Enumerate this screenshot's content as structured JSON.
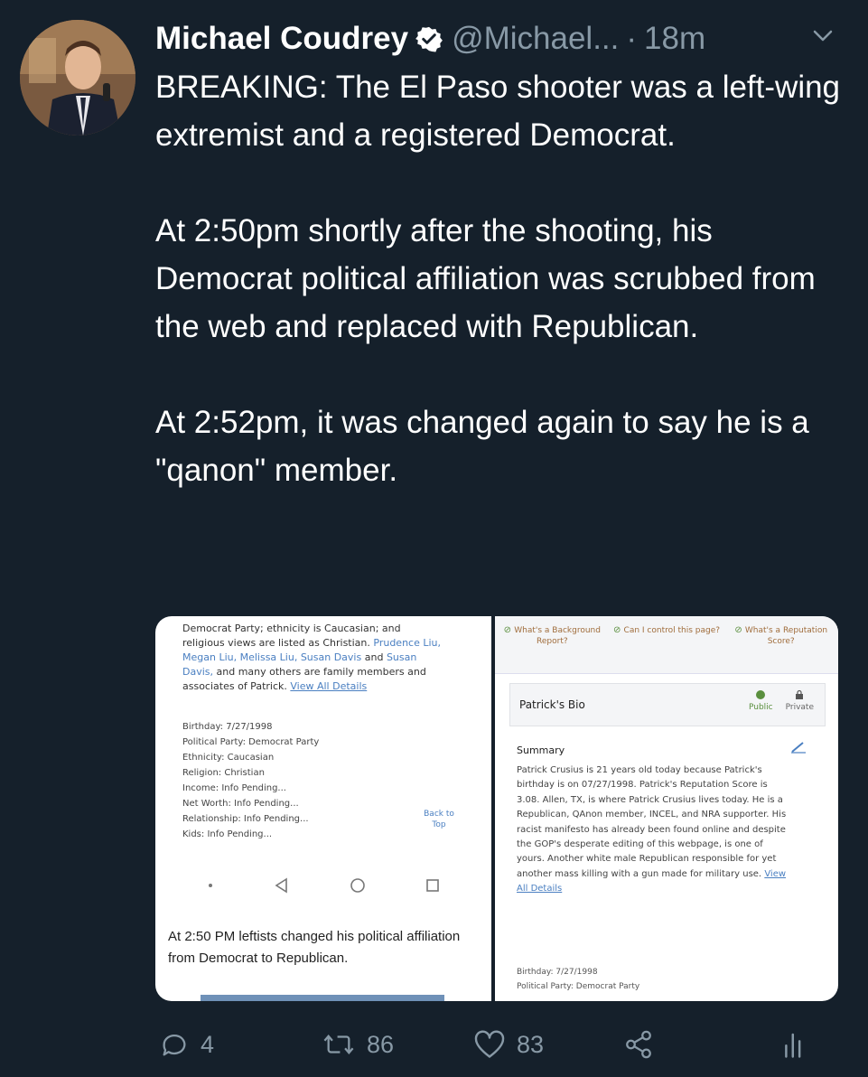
{
  "tweet": {
    "author_name": "Michael Coudrey",
    "handle": "@Michael...",
    "separator": "·",
    "time": "18m",
    "paragraphs": [
      "BREAKING: The El Paso shooter was a left-wing extremist and a registered Democrat.",
      "At 2:50pm shortly after the shooting, his Democrat political affiliation was scrubbed from the web and replaced with Republican.",
      "At 2:52pm, it was changed again to say he is a \"qanon\" member."
    ]
  },
  "media_left": {
    "intro_a": "Democrat Party; ethnicity is Caucasian; and religious views are listed as Christian.",
    "intro_names": "Prudence Liu, Megan Liu, Melissa Liu, Susan Davis",
    "intro_b": "and",
    "intro_names2": "Susan Davis,",
    "intro_c": "and many others are family members and associates of Patrick.",
    "view_all": "View All Details",
    "facts": [
      "Birthday: 7/27/1998",
      "Political Party: Democrat Party",
      "Ethnicity: Caucasian",
      "Religion: Christian",
      "Income: Info Pending...",
      "Net Worth: Info Pending...",
      "Relationship: Info Pending...",
      "Kids: Info Pending..."
    ],
    "back_to_top": "Back to Top",
    "caption": "At 2:50 PM leftists changed his political affiliation from Democrat to Republican."
  },
  "media_right": {
    "questions": [
      "What's a Background Report?",
      "Can I control this page?",
      "What's a Reputation Score?"
    ],
    "bio_title": "Patrick's Bio",
    "public_label": "Public",
    "private_label": "Private",
    "summary_label": "Summary",
    "summary_text": "Patrick Crusius is 21 years old today because Patrick's birthday is on 07/27/1998. Patrick's Reputation Score is 3.08. Allen, TX, is where Patrick Crusius lives today. He is a Republican, QAnon member, INCEL, and NRA supporter. His racist manifesto has already been found online and despite the GOP's desperate editing of this webpage, is one of yours. Another white male Republican responsible for yet another mass killing with a gun made for military use.",
    "view_all": "View All Details",
    "facts": [
      "Birthday: 7/27/1998",
      "Political Party: Democrat Party"
    ]
  },
  "actions": {
    "replies": "4",
    "retweets": "86",
    "likes": "83"
  },
  "colors": {
    "background": "#15202b",
    "secondary_text": "#8899a6",
    "verified": "#ffffff"
  }
}
